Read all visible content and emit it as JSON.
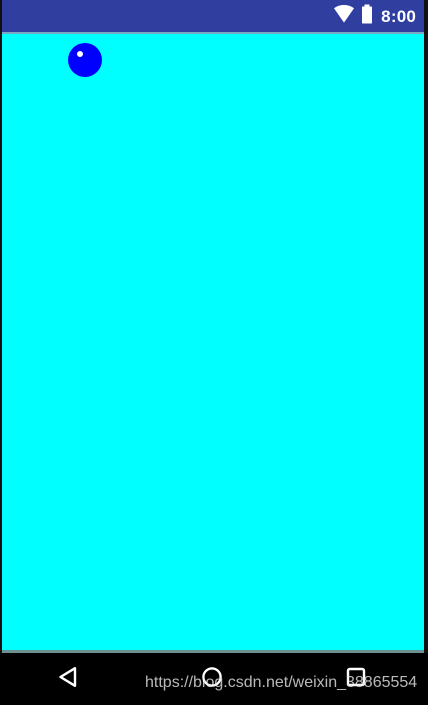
{
  "status_bar": {
    "time": "8:00",
    "icons": [
      "wifi-icon",
      "battery-icon"
    ],
    "background": "#303f9f"
  },
  "content": {
    "background": "#00ffff"
  },
  "ball": {
    "color": "#0000ff",
    "highlight_color": "#ffffff"
  },
  "navigation_bar": {
    "buttons": [
      "back-icon",
      "home-icon",
      "recents-icon"
    ],
    "background": "#000000"
  },
  "watermark": {
    "text": "https://blog.csdn.net/weixin_38865554"
  }
}
